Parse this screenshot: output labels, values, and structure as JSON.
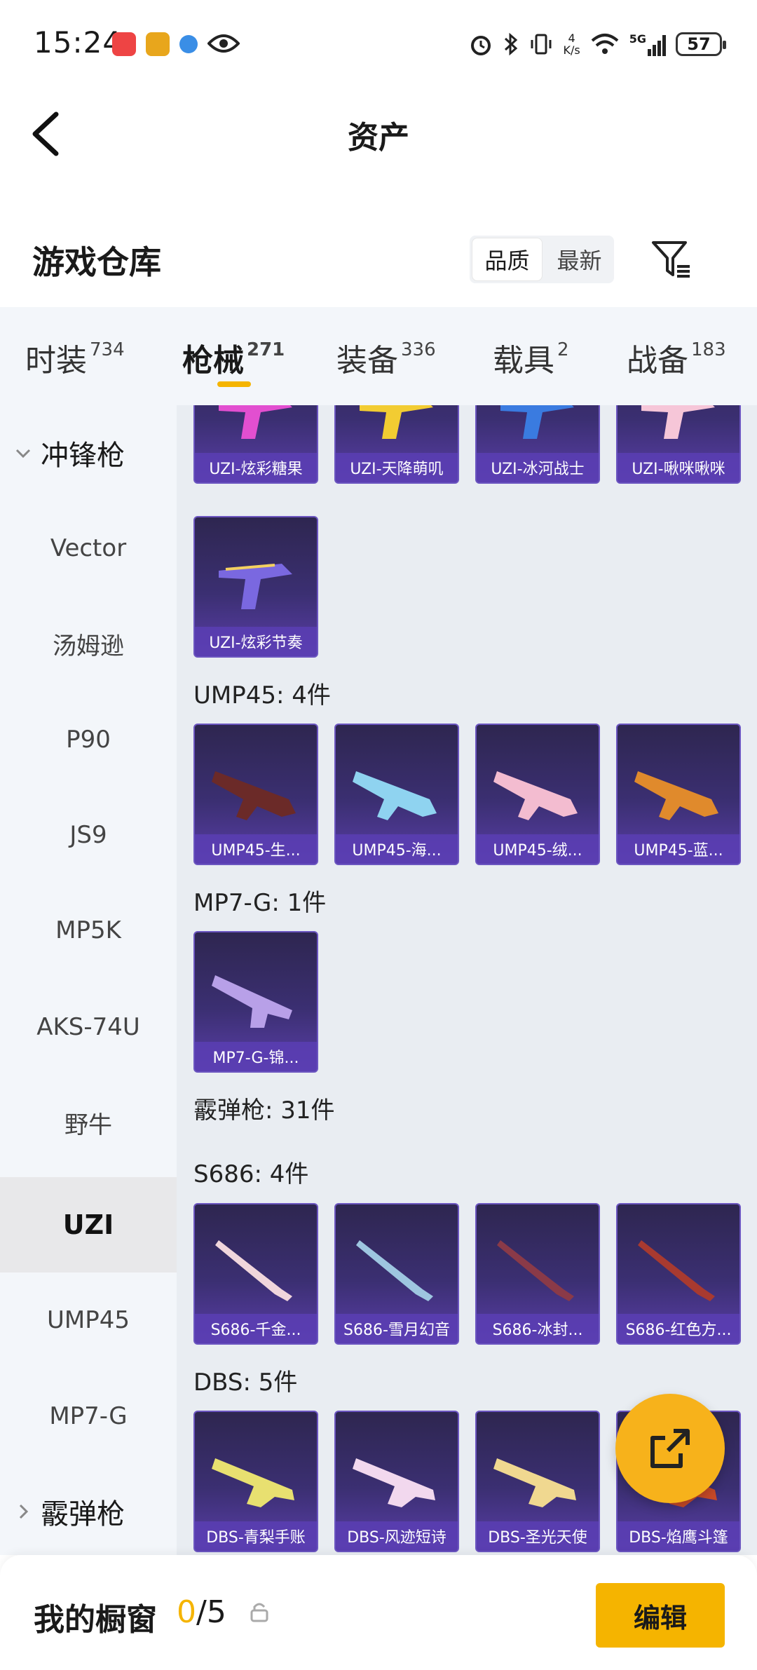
{
  "status_bar": {
    "time": "15:24",
    "network_speed_value": "4",
    "network_speed_unit": "K/s",
    "network_type": "5G",
    "battery": "57"
  },
  "header": {
    "title": "资产"
  },
  "section": {
    "title": "游戏仓库",
    "sort_options": [
      "品质",
      "最新"
    ],
    "sort_selected": "品质"
  },
  "tabs": [
    {
      "label": "时装",
      "count": "734"
    },
    {
      "label": "枪械",
      "count": "271"
    },
    {
      "label": "装备",
      "count": "336"
    },
    {
      "label": "载具",
      "count": "2"
    },
    {
      "label": "战备",
      "count": "183"
    }
  ],
  "sidebar": {
    "group_smg": "冲锋枪",
    "items": [
      "Vector",
      "汤姆逊",
      "P90",
      "JS9",
      "MP5K",
      "AKS-74U",
      "野牛",
      "UZI",
      "UMP45",
      "MP7-G"
    ],
    "active_item": "UZI",
    "group_shotgun": "霰弹枪"
  },
  "content": {
    "uzi_row1": [
      "UZI-炫彩糖果",
      "UZI-天降萌叽",
      "UZI-冰河战士",
      "UZI-啾咪啾咪"
    ],
    "uzi_row2": [
      "UZI-炫彩节奏"
    ],
    "ump45_label": "UMP45: 4件",
    "ump45_items": [
      "UMP45-生...",
      "UMP45-海...",
      "UMP45-绒...",
      "UMP45-蓝..."
    ],
    "mp7_label": "MP7-G: 1件",
    "mp7_items": [
      "MP7-G-锦..."
    ],
    "shotgun_label": "霰弹枪: 31件",
    "s686_label": "S686: 4件",
    "s686_items": [
      "S686-千金...",
      "S686-雪月幻音",
      "S686-冰封...",
      "S686-红色方..."
    ],
    "dbs_label": "DBS: 5件",
    "dbs_items": [
      "DBS-青梨手账",
      "DBS-风迹短诗",
      "DBS-圣光天使",
      "DBS-焰鹰斗篷"
    ]
  },
  "bottom_bar": {
    "label": "我的橱窗",
    "used": "0",
    "total": "/5",
    "edit_label": "编辑"
  },
  "colors": {
    "accent": "#f5b400",
    "card_bg": "#3b2f72",
    "card_label_bg": "#5a3ea8"
  }
}
